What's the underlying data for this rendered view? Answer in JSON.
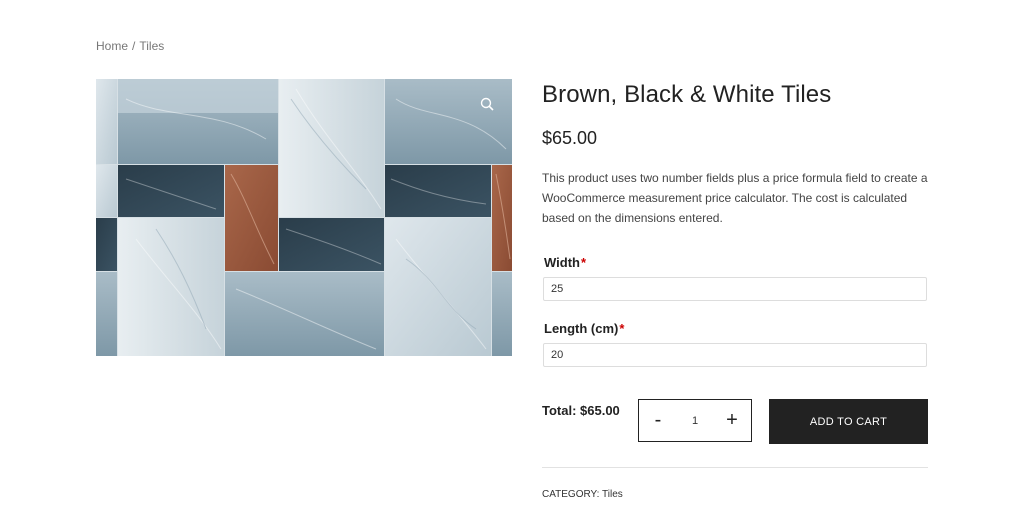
{
  "breadcrumb": {
    "home": "Home",
    "separator": "/",
    "current": "Tiles"
  },
  "product": {
    "title": "Brown, Black & White Tiles",
    "price": "$65.00",
    "description": "This product uses two number fields plus a price formula field to create a WooCommerce measurement price calculator. The cost is calculated based on the dimensions entered.",
    "image_icon": "zoom-icon"
  },
  "fields": {
    "width": {
      "label": "Width",
      "required_mark": "*",
      "value": "25"
    },
    "length": {
      "label": "Length (cm)",
      "required_mark": "*",
      "value": "20"
    }
  },
  "cart": {
    "total_label": "Total: $65.00",
    "quantity_minus": "-",
    "quantity_value": "1",
    "quantity_plus": "+",
    "add_to_cart_label": "ADD TO CART"
  },
  "meta": {
    "category_label": "CATEGORY:",
    "category_value": "Tiles"
  },
  "colors": {
    "button_bg": "#222222",
    "required": "#cc0000",
    "tile_light": "#c9d6dd",
    "tile_dark": "#2e4250",
    "tile_brown": "#9c5a3f"
  }
}
